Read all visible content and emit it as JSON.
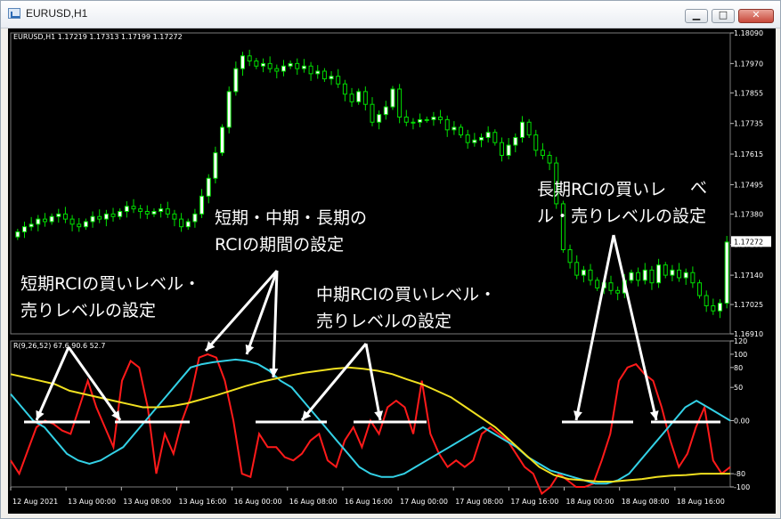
{
  "window": {
    "title": "EURUSD,H1",
    "buttons": {
      "minimize": "▁",
      "maximize": "□",
      "close": "✕"
    }
  },
  "header": {
    "symbol_text": "EURUSD,H1  1.17219 1.17313 1.17199 1.17272",
    "indicator_text": "R(9,26,52) 67.6 90.6 52.7"
  },
  "colors": {
    "background": "#000000",
    "grid": "#4a4a4a",
    "price_up": "#00e000",
    "price_down": "#ffffff",
    "short_rci": "#ff1a1a",
    "mid_rci": "#33d1e6",
    "long_rci": "#f0e020",
    "annotation": "#ffffff",
    "price_tag": "#ffffff"
  },
  "chart_data": [
    {
      "type": "candlestick",
      "symbol": "EURUSD",
      "timeframe": "H1",
      "ohlc_last": {
        "open": 1.17219,
        "high": 1.17313,
        "low": 1.17199,
        "close": 1.17272
      },
      "current_price_label": "1.17272",
      "ylim": [
        1.1691,
        1.1809
      ],
      "y_ticks": [
        "1.18090",
        "1.17970",
        "1.17855",
        "1.17735",
        "1.17615",
        "1.17495",
        "1.17380",
        "1.17260",
        "1.17140",
        "1.17025",
        "1.16910"
      ],
      "x_ticks": [
        "12 Aug 2021",
        "13 Aug 00:00",
        "13 Aug 08:00",
        "13 Aug 16:00",
        "16 Aug 00:00",
        "16 Aug 08:00",
        "16 Aug 16:00",
        "17 Aug 00:00",
        "17 Aug 08:00",
        "17 Aug 16:00",
        "18 Aug 00:00",
        "18 Aug 08:00",
        "18 Aug 16:00"
      ],
      "closes": [
        1.1731,
        1.1733,
        1.1734,
        1.1736,
        1.1735,
        1.1737,
        1.1738,
        1.1736,
        1.1734,
        1.1733,
        1.1735,
        1.1737,
        1.1736,
        1.1738,
        1.1737,
        1.1739,
        1.1741,
        1.174,
        1.1739,
        1.1738,
        1.1739,
        1.174,
        1.1738,
        1.1736,
        1.1733,
        1.1735,
        1.1738,
        1.1745,
        1.1752,
        1.1762,
        1.1772,
        1.1786,
        1.1795,
        1.18,
        1.1798,
        1.1796,
        1.1797,
        1.1795,
        1.1794,
        1.1796,
        1.1797,
        1.1795,
        1.1796,
        1.1793,
        1.1794,
        1.1791,
        1.1792,
        1.1789,
        1.1785,
        1.1782,
        1.1786,
        1.1781,
        1.1774,
        1.1777,
        1.178,
        1.1787,
        1.1776,
        1.1774,
        1.1774,
        1.1775,
        1.1775,
        1.1776,
        1.1775,
        1.1771,
        1.1772,
        1.1769,
        1.1766,
        1.1767,
        1.1768,
        1.177,
        1.1766,
        1.1761,
        1.1765,
        1.1768,
        1.1774,
        1.1769,
        1.1763,
        1.1761,
        1.1758,
        1.1742,
        1.1724,
        1.1719,
        1.1714,
        1.1716,
        1.1712,
        1.1709,
        1.1711,
        1.1708,
        1.1707,
        1.1712,
        1.1715,
        1.1712,
        1.1716,
        1.1711,
        1.1718,
        1.1714,
        1.1716,
        1.1713,
        1.1715,
        1.1711,
        1.1706,
        1.1702,
        1.17,
        1.1703,
        1.1727
      ]
    },
    {
      "type": "line",
      "indicator": "RCI",
      "params": [
        9,
        26,
        52
      ],
      "values_last": [
        67.6,
        90.6,
        52.7
      ],
      "ylim": [
        -100,
        120
      ],
      "y_ticks": [
        "120",
        "100",
        "80",
        "50",
        "0.00",
        "-80",
        "-100"
      ],
      "series": [
        {
          "values": [
            -60,
            -80,
            -45,
            -10,
            0,
            -5,
            -15,
            -20,
            20,
            60,
            20,
            -10,
            -40,
            60,
            90,
            80,
            20,
            -80,
            -20,
            -50,
            0,
            35,
            95,
            100,
            95,
            60,
            0,
            -80,
            -85,
            -20,
            -40,
            -40,
            -55,
            -60,
            -50,
            -30,
            -20,
            -60,
            -70,
            -30,
            -10,
            -40,
            0,
            -20,
            20,
            30,
            20,
            -20,
            60,
            -20,
            -50,
            -70,
            -60,
            -70,
            -60,
            -20,
            -10,
            -20,
            -30,
            -50,
            -70,
            -80,
            -110,
            -100,
            -80,
            -90,
            -100,
            -100,
            -95,
            -60,
            -20,
            60,
            80,
            85,
            70,
            60,
            20,
            -30,
            -70,
            -50,
            -10,
            20,
            -60,
            -80,
            -70
          ]
        },
        {
          "values": [
            40,
            20,
            0,
            -10,
            -30,
            -50,
            -60,
            -65,
            -60,
            -50,
            -40,
            -20,
            0,
            20,
            40,
            60,
            80,
            85,
            88,
            90,
            92,
            90,
            85,
            75,
            60,
            50,
            30,
            10,
            -10,
            -30,
            -50,
            -70,
            -80,
            -85,
            -85,
            -80,
            -70,
            -60,
            -50,
            -40,
            -30,
            -20,
            -10,
            -20,
            -30,
            -40,
            -55,
            -65,
            -75,
            -80,
            -85,
            -90,
            -95,
            -95,
            -90,
            -80,
            -60,
            -40,
            -20,
            0,
            20,
            30,
            20,
            10,
            0
          ]
        },
        {
          "values": [
            70,
            65,
            60,
            55,
            45,
            40,
            35,
            30,
            25,
            20,
            20,
            22,
            26,
            32,
            38,
            45,
            52,
            58,
            63,
            68,
            72,
            75,
            78,
            80,
            78,
            75,
            70,
            62,
            55,
            45,
            35,
            20,
            5,
            -10,
            -30,
            -50,
            -70,
            -82,
            -88,
            -90,
            -92,
            -92,
            -90,
            -88,
            -85,
            -83,
            -82,
            -80,
            -80,
            -80
          ]
        }
      ]
    }
  ],
  "annotations": {
    "short_rci": [
      "短期RCIの買いレベル・",
      "売りレベルの設定"
    ],
    "periods": [
      "短期・中期・長期の",
      "RCIの期間の設定"
    ],
    "mid_rci": [
      "中期RCIの買いレベル・",
      "売りレベルの設定"
    ],
    "long_rci": [
      "長期RCIの買いレ",
      "ル・売りレベルの設定"
    ],
    "long_rci_superscript": "べ"
  }
}
